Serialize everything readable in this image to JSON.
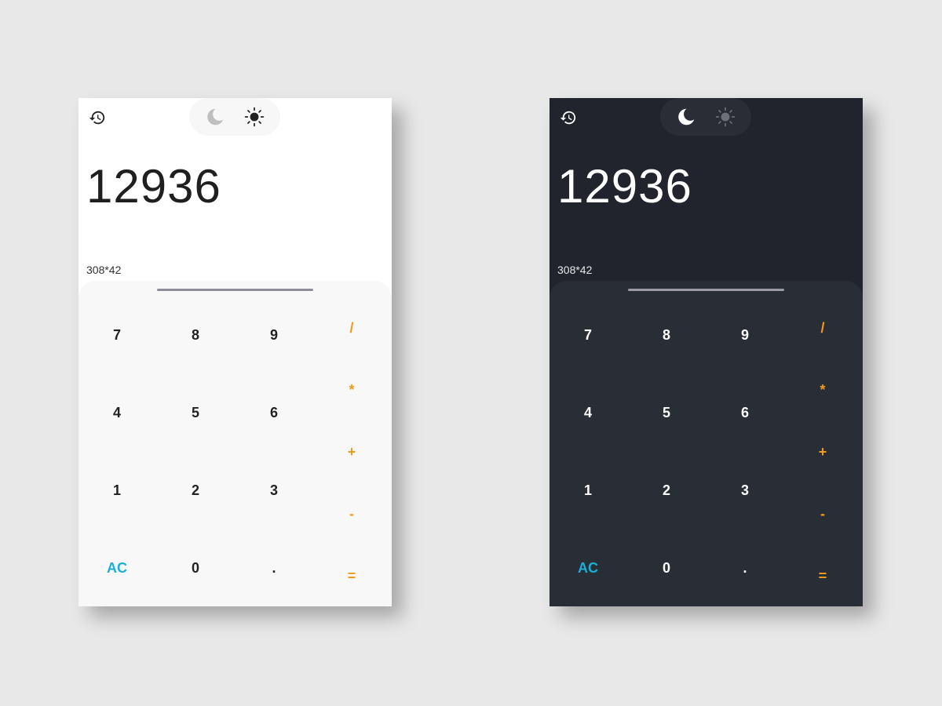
{
  "colors": {
    "page_background": "#e8e8e8",
    "light_surface": "#ffffff",
    "dark_surface": "#21242c",
    "operator_accent": "#f39a1a",
    "clear_accent": "#1ab0d8"
  },
  "calculators": {
    "light": {
      "theme": "light",
      "active_theme_icon": "sun-icon",
      "result": "12936",
      "expression": "308*42"
    },
    "dark": {
      "theme": "dark",
      "active_theme_icon": "moon-icon",
      "result": "12936",
      "expression": "308*42"
    }
  },
  "keypad": {
    "digits": [
      {
        "label": "7"
      },
      {
        "label": "8"
      },
      {
        "label": "9"
      },
      {
        "label": "4"
      },
      {
        "label": "5"
      },
      {
        "label": "6"
      },
      {
        "label": "1"
      },
      {
        "label": "2"
      },
      {
        "label": "3"
      },
      {
        "label": "AC"
      },
      {
        "label": "0"
      },
      {
        "label": "."
      }
    ],
    "operators": [
      {
        "label": "/"
      },
      {
        "label": "*"
      },
      {
        "label": "+"
      },
      {
        "label": "-"
      },
      {
        "label": "="
      }
    ]
  }
}
